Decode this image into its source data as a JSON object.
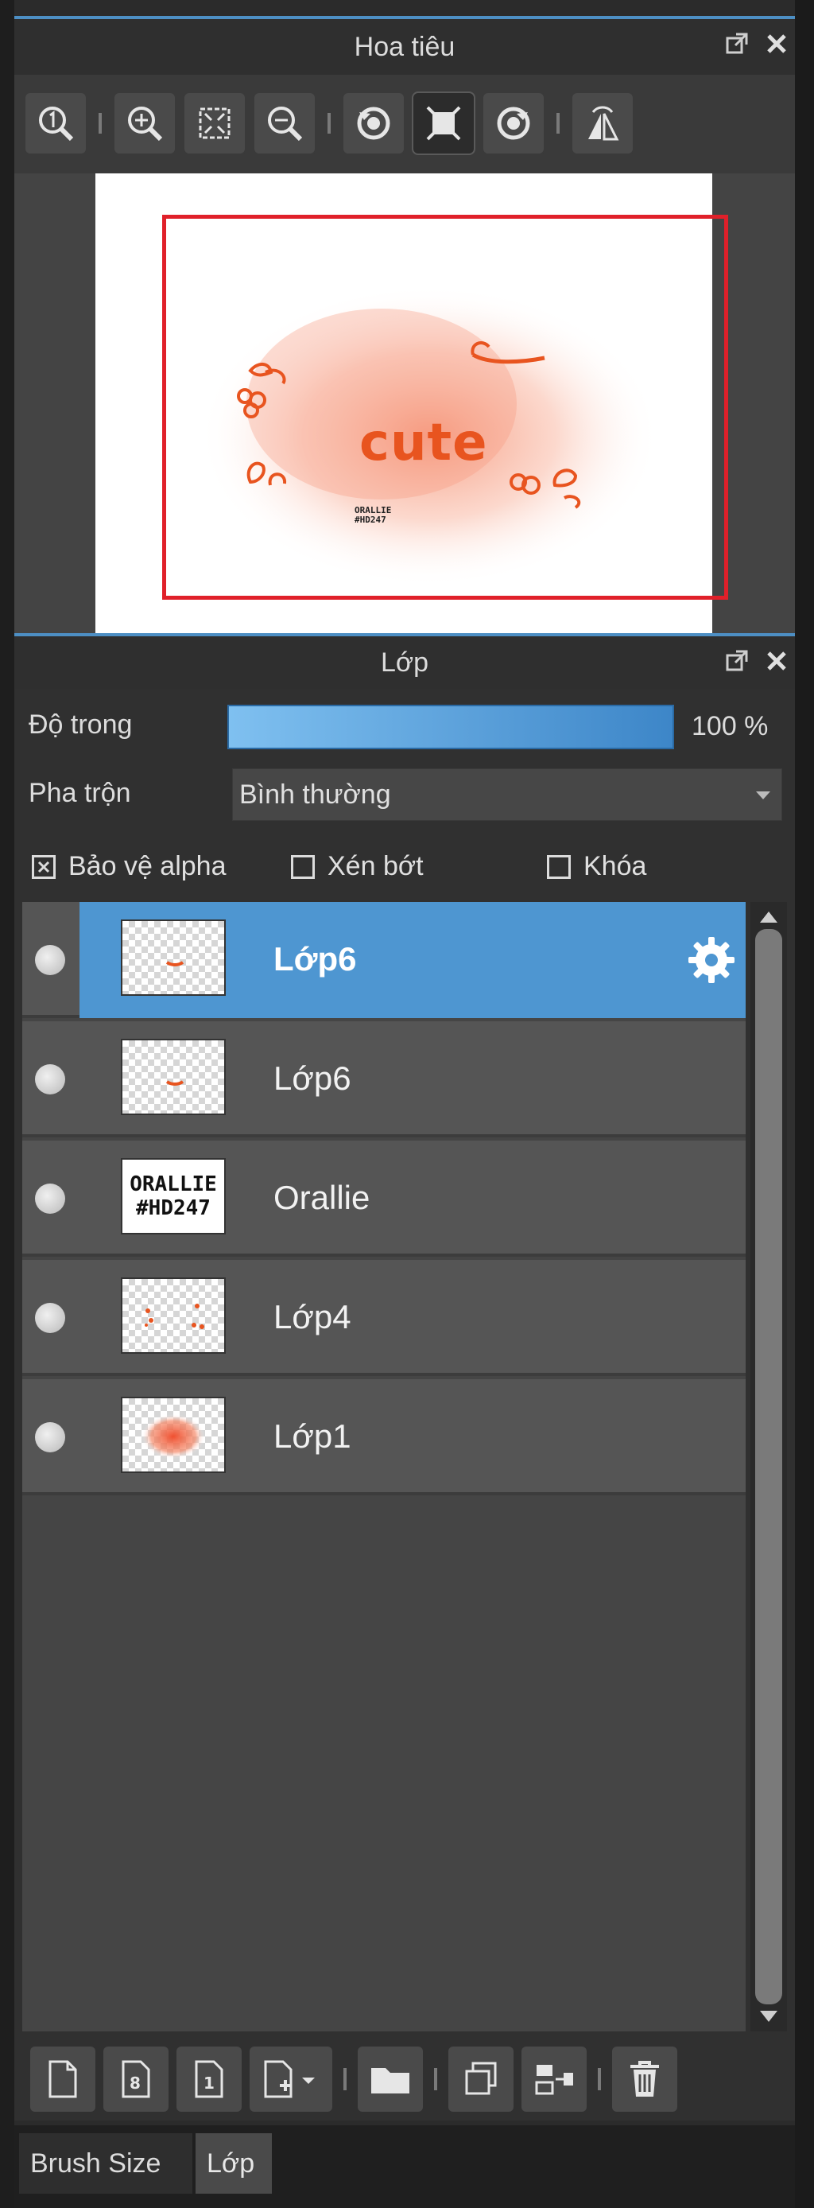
{
  "navigator": {
    "title": "Hoa tiêu",
    "header_icons": [
      "detach-icon",
      "close-icon"
    ],
    "toolbar": [
      {
        "name": "zoom-actual-size",
        "icon": "zoom-1-icon"
      },
      {
        "name": "zoom-in",
        "icon": "zoom-in-icon"
      },
      {
        "name": "fit-screen",
        "icon": "fit-screen-icon"
      },
      {
        "name": "zoom-out",
        "icon": "zoom-out-icon"
      },
      {
        "name": "rotate-left",
        "icon": "rotate-left-icon"
      },
      {
        "name": "reset-rotation",
        "icon": "reset-view-icon"
      },
      {
        "name": "rotate-right",
        "icon": "rotate-right-icon"
      },
      {
        "name": "flip-horizontal",
        "icon": "flip-horizontal-icon"
      }
    ],
    "preview": {
      "word": "cute",
      "signature_line1": "ORALLIE",
      "signature_line2": "#HD247",
      "viewport_color": "#e0202a"
    }
  },
  "layers": {
    "title": "Lớp",
    "opacity_label": "Độ trong",
    "opacity_value": "100 %",
    "opacity_fraction": 1.0,
    "blend_label": "Pha trộn",
    "blend_value": "Bình thường",
    "checks": {
      "protect_alpha": {
        "label": "Bảo vệ alpha",
        "checked": true
      },
      "clipping": {
        "label": "Xén bớt",
        "checked": false
      },
      "lock": {
        "label": "Khóa",
        "checked": false
      }
    },
    "items": [
      {
        "name": "Lớp6",
        "selected": true,
        "thumb": "small-orange-mark"
      },
      {
        "name": "Lớp6",
        "selected": false,
        "thumb": "small-orange-mark"
      },
      {
        "name": "Orallie",
        "selected": false,
        "thumb": "text",
        "thumb_line1": "ORALLIE",
        "thumb_line2": "#HD247"
      },
      {
        "name": "Lớp4",
        "selected": false,
        "thumb": "scattered-marks"
      },
      {
        "name": "Lớp1",
        "selected": false,
        "thumb": "orange-blob"
      }
    ],
    "bottom_toolbar": [
      "new-layer-icon",
      "new-8bit-layer-icon",
      "new-1bit-layer-icon",
      "add-layer-menu-icon",
      "folder-icon",
      "duplicate-layer-icon",
      "merge-down-icon",
      "delete-layer-icon"
    ],
    "accent": "#4e96d1"
  },
  "tabs": {
    "brush_size": "Brush Size",
    "layer": "Lớp"
  }
}
